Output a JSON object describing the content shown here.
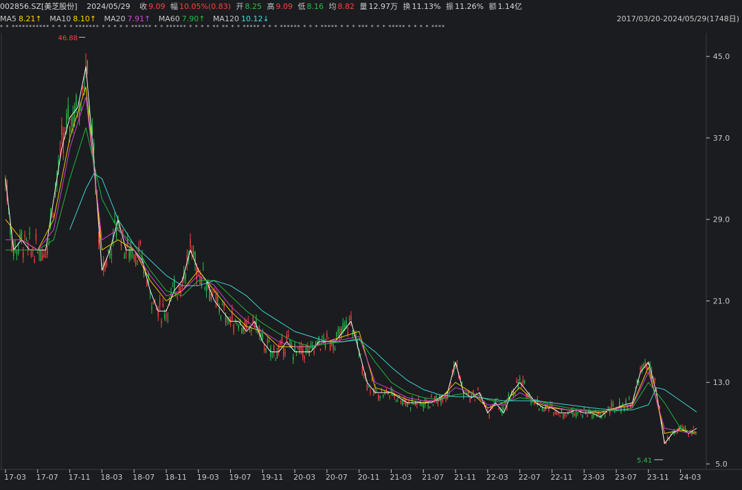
{
  "header": {
    "code": "002856.SZ[美芝股份]",
    "date": "2024/05/29",
    "close_label": "收",
    "close": "9.09",
    "amp_label": "幅",
    "amp": "10.05%(0.83)",
    "open_label": "开",
    "open": "8.25",
    "high_label": "高",
    "high": "9.09",
    "low_label": "低",
    "low": "8.16",
    "avg_label": "均",
    "avg": "8.82",
    "vol_label": "量",
    "vol": "12.97万",
    "turn_label": "换",
    "turn": "11.13%",
    "swing_label": "振",
    "swing": "11.26%",
    "amt_label": "额",
    "amt": "1.14亿"
  },
  "ma_header": {
    "ma5_label": "MA5",
    "ma5": "8.21↑",
    "ma10_label": "MA10",
    "ma10": "8.10↑",
    "ma20_label": "MA20",
    "ma20": "7.91↑",
    "ma60_label": "MA60",
    "ma60": "7.90↑",
    "ma120_label": "MA120",
    "ma120": "10.12↓",
    "range": "2017/03/20-2024/05/29(1748日)"
  },
  "stars": "* *    ***********  *  * * *    ******* * *  *  * *  ****** * *   ****** * *  * *    ** ** *  * ***** * *  * ******  *   * *    *****  * * * ***    * * *   ***** * *  * *   ****",
  "colors": {
    "ma5": "#ffffff",
    "ma10": "#ffd400",
    "ma20": "#e040e0",
    "ma60": "#20c040",
    "ma120": "#40e0e0",
    "up": "#ff4040",
    "down": "#27c04a",
    "axis": "#c8c8c8",
    "grid": "#2a2b2f"
  },
  "chart_data": {
    "type": "line",
    "title": "",
    "ylim": [
      5.0,
      46.9
    ],
    "yticks": [
      5.0,
      13.0,
      21.0,
      29.0,
      37.0,
      45.0
    ],
    "ytick_labels": [
      "5.0",
      "13.0",
      "21.0",
      "29.0",
      "37.0",
      "45.0"
    ],
    "xticks": [
      "17-03",
      "17-07",
      "17-11",
      "18-03",
      "18-07",
      "18-11",
      "19-03",
      "19-07",
      "19-11",
      "20-03",
      "20-07",
      "20-11",
      "21-03",
      "21-07",
      "21-11",
      "22-03",
      "22-07",
      "22-11",
      "23-03",
      "23-07",
      "23-11",
      "24-03"
    ],
    "annotations": [
      {
        "text": "46.88",
        "x": "18-01",
        "y": 46.88
      },
      {
        "text": "5.41",
        "x": "24-01",
        "y": 5.41
      }
    ],
    "series": [
      {
        "name": "MA5",
        "x": [
          "17-03",
          "17-04",
          "17-05",
          "17-06",
          "17-07",
          "17-08",
          "17-09",
          "17-10",
          "17-11",
          "17-12",
          "18-01",
          "18-02",
          "18-03",
          "18-04",
          "18-05",
          "18-06",
          "18-07",
          "18-08",
          "18-09",
          "18-10",
          "18-11",
          "18-12",
          "19-01",
          "19-02",
          "19-03",
          "19-04",
          "19-05",
          "19-06",
          "19-07",
          "19-08",
          "19-09",
          "19-10",
          "19-11",
          "19-12",
          "20-01",
          "20-02",
          "20-03",
          "20-04",
          "20-05",
          "20-06",
          "20-07",
          "20-08",
          "20-09",
          "20-10",
          "20-11",
          "20-12",
          "21-01",
          "21-02",
          "21-03",
          "21-04",
          "21-05",
          "21-06",
          "21-07",
          "21-08",
          "21-09",
          "21-10",
          "21-11",
          "21-12",
          "22-01",
          "22-02",
          "22-03",
          "22-04",
          "22-05",
          "22-06",
          "22-07",
          "22-08",
          "22-09",
          "22-10",
          "22-11",
          "22-12",
          "23-01",
          "23-02",
          "23-03",
          "23-04",
          "23-05",
          "23-06",
          "23-07",
          "23-08",
          "23-09",
          "23-10",
          "23-11",
          "23-12",
          "24-01",
          "24-02",
          "24-03",
          "24-04",
          "24-05"
        ],
        "values": [
          33,
          26,
          27,
          26,
          26,
          26,
          31,
          36,
          39,
          40,
          44,
          35,
          24,
          26,
          29,
          26,
          26,
          25,
          22,
          20,
          20,
          22,
          23,
          26,
          24,
          23,
          21,
          20,
          19,
          19,
          18,
          19,
          17,
          16,
          16,
          17,
          16,
          16,
          16,
          17,
          17,
          17,
          18,
          19,
          16,
          13,
          12,
          12,
          12,
          11.5,
          11,
          11,
          11,
          11,
          11.5,
          12,
          15,
          12,
          11.5,
          12,
          10,
          11,
          10,
          12,
          13,
          12,
          11,
          10.5,
          10.5,
          10,
          10,
          10.3,
          10,
          10,
          9.6,
          10.3,
          10.5,
          10.8,
          11,
          14,
          15,
          12,
          7,
          8,
          8.5,
          8,
          8.5
        ]
      },
      {
        "name": "MA10",
        "x": [
          "17-03",
          "17-05",
          "17-07",
          "17-09",
          "17-11",
          "18-01",
          "18-03",
          "18-05",
          "18-07",
          "18-09",
          "18-11",
          "19-01",
          "19-03",
          "19-05",
          "19-07",
          "19-09",
          "19-11",
          "20-01",
          "20-03",
          "20-05",
          "20-07",
          "20-09",
          "20-11",
          "21-01",
          "21-03",
          "21-05",
          "21-07",
          "21-09",
          "21-11",
          "22-01",
          "22-03",
          "22-05",
          "22-07",
          "22-09",
          "22-11",
          "23-01",
          "23-03",
          "23-05",
          "23-07",
          "23-09",
          "23-11",
          "24-01",
          "24-03",
          "24-05"
        ],
        "values": [
          29,
          27,
          26,
          29,
          37,
          42,
          26,
          27,
          26,
          23,
          21,
          22,
          24,
          22,
          20,
          18.5,
          18,
          16.5,
          16.5,
          16.5,
          17,
          17.5,
          18,
          12.5,
          12,
          11.3,
          11,
          11.3,
          13,
          12,
          10.5,
          11,
          12.5,
          11,
          10.5,
          10.3,
          10.2,
          10,
          10.5,
          10.8,
          14.5,
          8,
          8.3,
          8.1
        ]
      },
      {
        "name": "MA20",
        "x": [
          "17-03",
          "17-05",
          "17-07",
          "17-09",
          "17-11",
          "18-01",
          "18-03",
          "18-05",
          "18-07",
          "18-09",
          "18-11",
          "19-01",
          "19-03",
          "19-05",
          "19-07",
          "19-09",
          "19-11",
          "20-01",
          "20-03",
          "20-05",
          "20-07",
          "20-09",
          "20-11",
          "21-01",
          "21-03",
          "21-05",
          "21-07",
          "21-09",
          "21-11",
          "22-01",
          "22-03",
          "22-05",
          "22-07",
          "22-09",
          "22-11",
          "23-01",
          "23-03",
          "23-05",
          "23-07",
          "23-09",
          "23-11",
          "24-01",
          "24-03",
          "24-05"
        ],
        "values": [
          27,
          27,
          26,
          28,
          36,
          41,
          27,
          28,
          26,
          23.5,
          21.5,
          22,
          23.5,
          22.5,
          20.5,
          19,
          18,
          17,
          16.5,
          16.5,
          17,
          17.2,
          17.5,
          13,
          12.3,
          11.5,
          11.2,
          11.2,
          12.5,
          12,
          10.8,
          10.8,
          12,
          11.2,
          10.6,
          10.3,
          10.2,
          10.1,
          10.4,
          10.7,
          14,
          8.5,
          8.2,
          7.9
        ]
      },
      {
        "name": "MA60",
        "x": [
          "17-03",
          "17-05",
          "17-07",
          "17-09",
          "17-11",
          "18-01",
          "18-03",
          "18-05",
          "18-07",
          "18-09",
          "18-11",
          "19-01",
          "19-03",
          "19-05",
          "19-07",
          "19-09",
          "19-11",
          "20-01",
          "20-03",
          "20-05",
          "20-07",
          "20-09",
          "20-11",
          "21-01",
          "21-03",
          "21-05",
          "21-07",
          "21-09",
          "21-11",
          "22-01",
          "22-03",
          "22-05",
          "22-07",
          "22-09",
          "22-11",
          "23-01",
          "23-03",
          "23-05",
          "23-07",
          "23-09",
          "23-11",
          "24-01",
          "24-03",
          "24-05"
        ],
        "values": [
          26,
          26,
          26,
          27,
          33,
          38,
          31,
          28,
          26.5,
          24,
          22,
          21.5,
          23,
          23,
          21.5,
          20,
          18.8,
          17.8,
          17,
          16.5,
          16.8,
          17,
          17.3,
          15,
          13,
          12,
          11.5,
          11.3,
          11.8,
          12,
          11.3,
          11,
          11.5,
          11.3,
          10.8,
          10.5,
          10.3,
          10.2,
          10.2,
          10.5,
          13,
          11,
          8.5,
          7.9
        ]
      },
      {
        "name": "MA120",
        "x": [
          "17-11",
          "17-12",
          "18-01",
          "18-02",
          "18-03",
          "18-04",
          "18-05",
          "18-07",
          "18-09",
          "18-11",
          "19-01",
          "19-03",
          "19-05",
          "19-07",
          "19-09",
          "19-11",
          "20-01",
          "20-03",
          "20-05",
          "20-07",
          "20-09",
          "20-11",
          "21-01",
          "21-03",
          "21-05",
          "21-07",
          "21-09",
          "21-11",
          "22-01",
          "22-03",
          "22-05",
          "22-07",
          "22-09",
          "22-11",
          "23-01",
          "23-03",
          "23-05",
          "23-07",
          "23-09",
          "23-11",
          "23-12",
          "24-01",
          "24-03",
          "24-05"
        ],
        "values": [
          28,
          30,
          32,
          33.5,
          33,
          31,
          29,
          26.5,
          25,
          23.5,
          22.5,
          22.5,
          23,
          22.5,
          21.5,
          20,
          19,
          18,
          17.5,
          17,
          17,
          17.2,
          16,
          14.5,
          13.2,
          12.3,
          11.8,
          11.6,
          11.6,
          11.4,
          11.2,
          11.2,
          11.2,
          11,
          10.8,
          10.6,
          10.4,
          10.3,
          10.3,
          10.8,
          12.5,
          12.3,
          11.2,
          10.1
        ]
      }
    ]
  }
}
